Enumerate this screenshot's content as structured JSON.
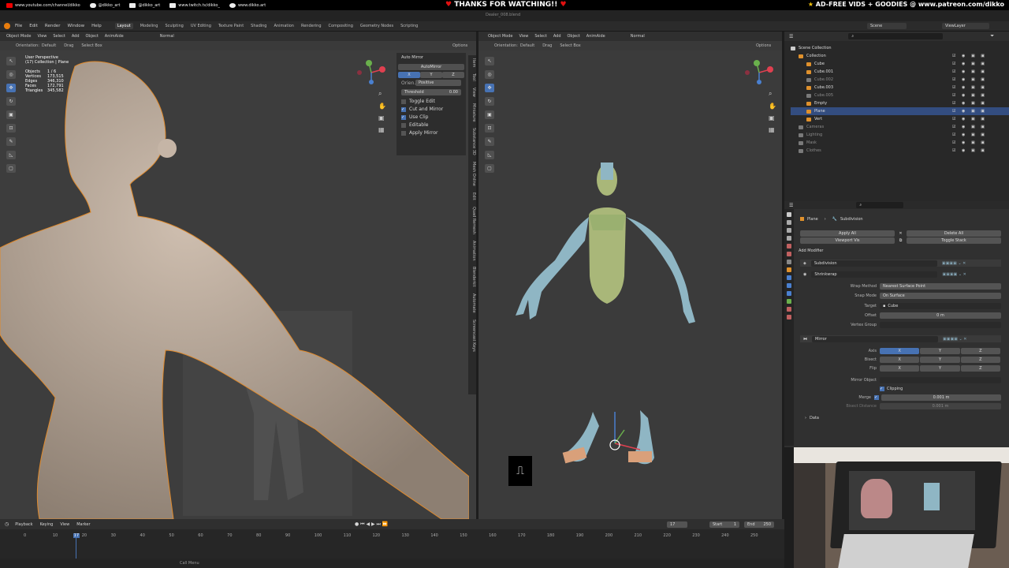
{
  "banner": {
    "youtube": "www.youtube.com/channel/dikko",
    "instagram": "@dikko_art",
    "twitter": "@dikko_art",
    "twitch": "www.twitch.tv/dikko_",
    "web": "www.dikko.art",
    "thanks": "THANKS FOR WATCHING!!",
    "patreon": "AD-FREE VIDS + GOODIES @ www.patreon.com/dikko"
  },
  "window": {
    "title": "Dealer_008.blend"
  },
  "menu": [
    "File",
    "Edit",
    "Render",
    "Window",
    "Help"
  ],
  "workspaces": [
    "Layout",
    "Modeling",
    "Sculpting",
    "UV Editing",
    "Texture Paint",
    "Shading",
    "Animation",
    "Rendering",
    "Compositing",
    "Geometry Nodes",
    "Scripting"
  ],
  "active_workspace": "Layout",
  "top_right": {
    "scene": "Scene",
    "view_layer": "ViewLayer"
  },
  "left_viewport": {
    "mode": "Object Mode",
    "menus": [
      "View",
      "Select",
      "Add",
      "Object",
      "AnimAide"
    ],
    "transform": "Normal",
    "orientation_label": "Orientation:",
    "orientation": "Default",
    "drag_label": "Drag",
    "select_box": "Select Box",
    "options": "Options",
    "perspective": "User Perspective",
    "collection": "(17) Collection | Plane",
    "stats": [
      {
        "label": "Objects",
        "value": "1 / 6"
      },
      {
        "label": "Vertices",
        "value": "173,515"
      },
      {
        "label": "Edges",
        "value": "346,310"
      },
      {
        "label": "Faces",
        "value": "172,791"
      },
      {
        "label": "Triangles",
        "value": "345,582"
      }
    ],
    "automirror": {
      "header": "Auto Mirror",
      "button": "AutoMirror",
      "axes": [
        "X",
        "Y",
        "Z"
      ],
      "orientation_label": "Orien...",
      "orientation_value": "Positive",
      "threshold_label": "Threshold",
      "threshold_value": "0.00",
      "options": [
        {
          "label": "Toggle Edit",
          "checked": false
        },
        {
          "label": "Cut and Mirror",
          "checked": true
        },
        {
          "label": "Use Clip",
          "checked": true
        },
        {
          "label": "Editable",
          "checked": false
        },
        {
          "label": "Apply Mirror",
          "checked": false
        }
      ]
    },
    "sidetabs": [
      "Item",
      "Tool",
      "View",
      "Miniature",
      "Substance 3D",
      "Mesh Online",
      "Edit",
      "Quad Remesh",
      "Animation",
      "Blenderkit",
      "Automate",
      "Screencast Keys"
    ]
  },
  "right_viewport": {
    "mode": "Object Mode",
    "menus": [
      "View",
      "Select",
      "Add",
      "Object",
      "AnimAide"
    ],
    "transform": "Normal",
    "orientation_label": "Orientation:",
    "orientation": "Default",
    "drag_label": "Drag",
    "select_box": "Select Box",
    "options": "Options"
  },
  "outliner": {
    "search_placeholder": "",
    "items": [
      {
        "name": "Scene Collection",
        "indent": 0,
        "color": "#cccccc"
      },
      {
        "name": "Collection",
        "indent": 1,
        "color": "#e0912c"
      },
      {
        "name": "Cube",
        "indent": 2,
        "color": "#e0912c"
      },
      {
        "name": "Cube.001",
        "indent": 2,
        "color": "#e0912c"
      },
      {
        "name": "Cube.002",
        "indent": 2,
        "color": "#7a7a7a"
      },
      {
        "name": "Cube.003",
        "indent": 2,
        "color": "#e0912c"
      },
      {
        "name": "Cube.005",
        "indent": 2,
        "color": "#7a7a7a"
      },
      {
        "name": "Empty",
        "indent": 2,
        "color": "#e0912c"
      },
      {
        "name": "Plane",
        "indent": 2,
        "color": "#e0912c",
        "selected": true
      },
      {
        "name": "Vert",
        "indent": 2,
        "color": "#e0912c"
      },
      {
        "name": "Cameras",
        "indent": 1,
        "color": "#7a7a7a"
      },
      {
        "name": "Lighting",
        "indent": 1,
        "color": "#7a7a7a"
      },
      {
        "name": "Mask",
        "indent": 1,
        "color": "#7a7a7a"
      },
      {
        "name": "Clothes",
        "indent": 1,
        "color": "#7a7a7a"
      }
    ]
  },
  "properties": {
    "breadcrumb_object": "Plane",
    "breadcrumb_modifier": "Subdivision",
    "apply_all": "Apply All",
    "delete_all": "Delete All",
    "viewport_vis": "Viewport Vis",
    "toggle_stack": "Toggle Stack",
    "add_modifier": "Add Modifier",
    "modifiers": [
      "Subdivision",
      "Shrinkwrap"
    ],
    "shrinkwrap": {
      "wrap_method_label": "Wrap Method",
      "wrap_method": "Nearest Surface Point",
      "snap_mode_label": "Snap Mode",
      "snap_mode": "On Surface",
      "target_label": "Target",
      "target": "Cube",
      "offset_label": "Offset",
      "offset": "0 m",
      "vertex_group_label": "Vertex Group"
    },
    "mirror": {
      "name": "Mirror",
      "axis_label": "Axis",
      "bisect_label": "Bisect",
      "flip_label": "Flip",
      "axes": [
        "X",
        "Y",
        "Z"
      ],
      "mirror_object_label": "Mirror Object",
      "clipping_label": "Clipping",
      "merge_label": "Merge",
      "merge_value": "0.001 m",
      "bisect_distance_label": "Bisect Distance",
      "bisect_distance": "0.001 m",
      "data_label": "Data"
    }
  },
  "timeline": {
    "menus": [
      "Playback",
      "Keying",
      "View",
      "Marker"
    ],
    "current_frame": "17",
    "start_label": "Start",
    "start": "1",
    "end_label": "End",
    "end": "250",
    "ticks": [
      "0",
      "10",
      "17",
      "20",
      "30",
      "40",
      "50",
      "60",
      "70",
      "80",
      "90",
      "100",
      "110",
      "120",
      "130",
      "140",
      "150",
      "160",
      "170",
      "180",
      "190",
      "200",
      "210",
      "220",
      "230",
      "240",
      "250"
    ],
    "status": "Call Menu"
  },
  "colors": {
    "accent": "#4772b3",
    "viewport_bg": "#3d3d3d",
    "selection_outline": "#e08a2c",
    "skin": "#bba99a",
    "body_green": "#a9b779",
    "limb_blue": "#8fb6c4"
  }
}
